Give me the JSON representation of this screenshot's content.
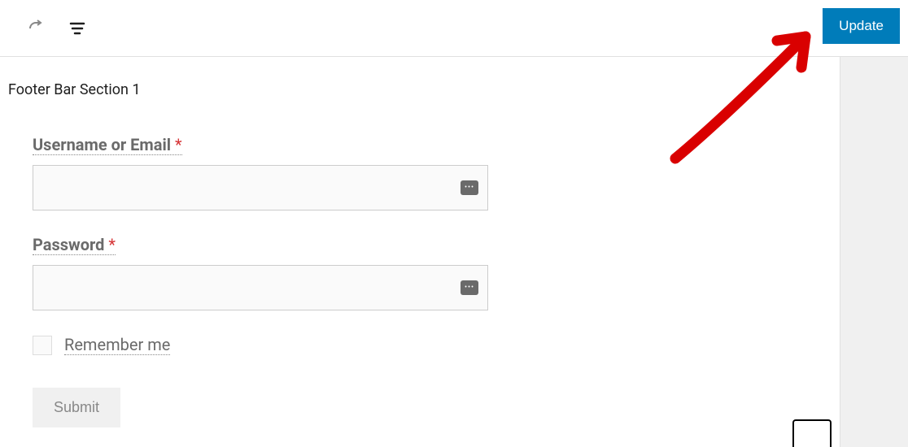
{
  "toolbar": {
    "update_label": "Update"
  },
  "block": {
    "title": "Footer Bar Section 1"
  },
  "form": {
    "username": {
      "label": "Username or Email",
      "required_mark": "*",
      "value": ""
    },
    "password": {
      "label": "Password",
      "required_mark": "*",
      "value": ""
    },
    "remember": {
      "label": "Remember me",
      "checked": false
    },
    "submit": {
      "label": "Submit"
    }
  }
}
